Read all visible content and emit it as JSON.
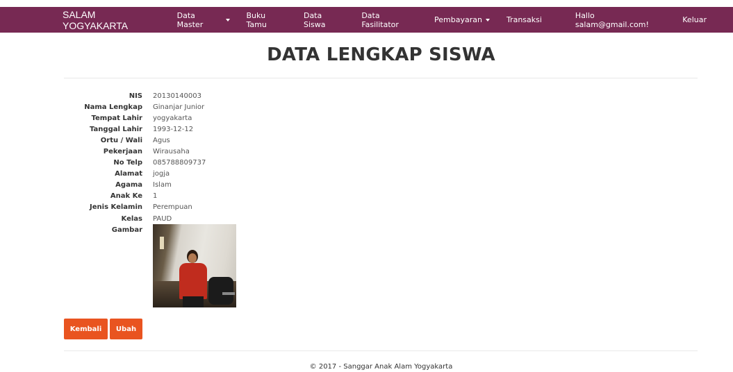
{
  "navbar": {
    "brand": "SALAM YOGYAKARTA",
    "items": [
      {
        "label": "Data Master",
        "dropdown": true
      },
      {
        "label": "Buku Tamu",
        "dropdown": false
      },
      {
        "label": "Data Siswa",
        "dropdown": false
      },
      {
        "label": "Data Fasilitator",
        "dropdown": false
      },
      {
        "label": "Pembayaran",
        "dropdown": true
      },
      {
        "label": "Transaksi",
        "dropdown": false
      }
    ],
    "greeting": "Hallo salam@gmail.com!",
    "logout": "Keluar",
    "bg_color": "#772953"
  },
  "page": {
    "title": "DATA LENGKAP SISWA"
  },
  "student": {
    "fields": [
      {
        "label": "NIS",
        "value": "20130140003"
      },
      {
        "label": "Nama Lengkap",
        "value": "Ginanjar Junior"
      },
      {
        "label": "Tempat Lahir",
        "value": "yogyakarta"
      },
      {
        "label": "Tanggal Lahir",
        "value": "1993-12-12"
      },
      {
        "label": "Ortu / Wali",
        "value": "Agus"
      },
      {
        "label": "Pekerjaan",
        "value": "Wirausaha"
      },
      {
        "label": "No Telp",
        "value": "085788809737"
      },
      {
        "label": "Alamat",
        "value": "jogja"
      },
      {
        "label": "Agama",
        "value": "Islam"
      },
      {
        "label": "Anak Ke",
        "value": "1"
      },
      {
        "label": "Jenis Kelamin",
        "value": "Perempuan"
      },
      {
        "label": "Kelas",
        "value": "PAUD"
      }
    ],
    "photo_label": "Gambar"
  },
  "actions": {
    "back_label": "Kembali",
    "edit_label": "Ubah",
    "accent": "#e95420"
  },
  "footer": {
    "text": "© 2017 - Sanggar Anak Alam Yogyakarta"
  }
}
